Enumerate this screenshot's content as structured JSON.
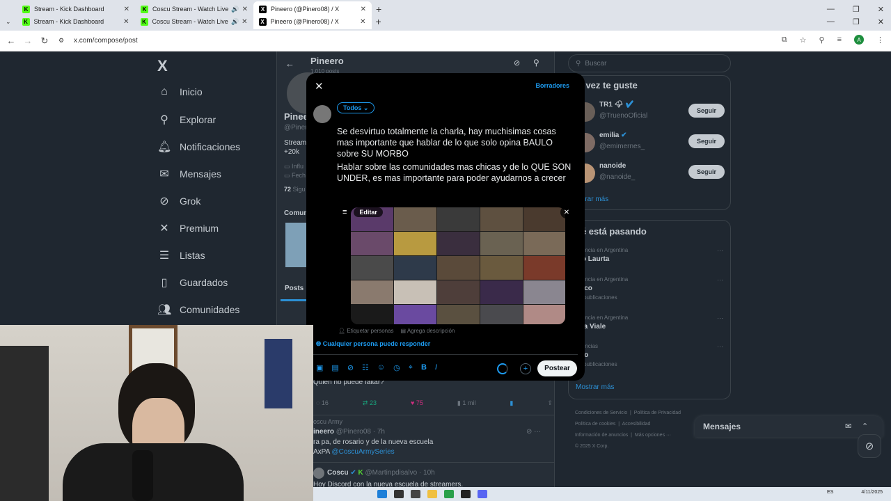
{
  "browser": {
    "tabs_row1": [
      {
        "title": "Stream - Kick Dashboard",
        "favicon": "kick"
      },
      {
        "title": "Coscu Stream - Watch Live",
        "favicon": "kick",
        "audio": true
      },
      {
        "title": "Pineero (@Pinero08) / X",
        "favicon": "x",
        "active": true
      }
    ],
    "tabs_row2": [
      {
        "title": "Stream - Kick Dashboard",
        "favicon": "kick"
      },
      {
        "title": "Coscu Stream - Watch Live",
        "favicon": "kick",
        "audio": true
      },
      {
        "title": "Pineero (@Pinero08) / X",
        "favicon": "x",
        "active": true
      }
    ],
    "url": "x.com/compose/post",
    "profile_initial": "A",
    "new_tab_glyph": "+",
    "close_glyph": "✕"
  },
  "leftnav": {
    "logo": "X",
    "items": [
      {
        "label": "Inicio",
        "icon": "home-icon"
      },
      {
        "label": "Explorar",
        "icon": "search-icon"
      },
      {
        "label": "Notificaciones",
        "icon": "bell-icon"
      },
      {
        "label": "Mensajes",
        "icon": "mail-icon"
      },
      {
        "label": "Grok",
        "icon": "grok-icon"
      },
      {
        "label": "Premium",
        "icon": "x-icon"
      },
      {
        "label": "Listas",
        "icon": "list-icon"
      },
      {
        "label": "Guardados",
        "icon": "bookmark-icon"
      },
      {
        "label": "Comunidades",
        "icon": "people-icon"
      }
    ]
  },
  "profile": {
    "name": "Pineero",
    "posts_count": "1.010 posts",
    "name_partial": "Pinee",
    "handle_partial": "@Piner",
    "bio_partial": "Streame",
    "followers_partial": "+20k",
    "info1": "Influ",
    "info2": "Fech",
    "following": "72",
    "following_label": "Sigu",
    "tab_communities": "Comun",
    "tab_posts": "Posts"
  },
  "timeline": {
    "tweet1_text": "Quien no puede faltar?",
    "tweet1_stats": {
      "replies": "16",
      "retweets": "23",
      "likes": "75",
      "views": "1 mil"
    },
    "community": "oscu Army",
    "tweet2_author": "ineero",
    "tweet2_handle": "@Pinero08 · 7h",
    "tweet2_text": "ra pa, de rosario y de la nueva escuela",
    "tweet2_text2_prefix": "AxPA ",
    "tweet2_mention": "@CoscuArmySeries",
    "tweet3_author": "Coscu",
    "tweet3_handle": "@Martinpdisalvo · 10h",
    "tweet3_text": "Hoy Discord con la nueva escuela de streamers."
  },
  "rightcol": {
    "search_placeholder": "Buscar",
    "suggest_title": "al vez te guste",
    "suggestions": [
      {
        "name": "TR1 🌩",
        "handle": "@TruenoOficial",
        "button": "Seguir"
      },
      {
        "name": "emilia",
        "handle": "@emimernes_",
        "button": "Seguir"
      },
      {
        "name": "nanoide",
        "handle": "@nanoide_",
        "button": "Seguir"
      }
    ],
    "show_more": "ostrar más",
    "trends_title": "ué está pasando",
    "trends": [
      {
        "context": "ndencia en Argentina",
        "title": "blo Laurta",
        "count": ""
      },
      {
        "context": "ndencia en Argentina",
        "title": "onco",
        "count": "64 publicaciones"
      },
      {
        "context": "ndencia en Argentina",
        "title": "ana Viale",
        "count": ""
      },
      {
        "context": "ndencias",
        "title": "ugo",
        "count": "26 publicaciones"
      }
    ],
    "show_more2": "Mostrar más",
    "footer": [
      "Condiciones de Servicio",
      "Política de Privacidad",
      "Política de cookies",
      "Accesibilidad",
      "Información de anuncios",
      "Más opciones ···",
      "© 2025 X Corp."
    ],
    "messages": "Mensajes"
  },
  "compose": {
    "close": "✕",
    "drafts": "Borradores",
    "audience": "Todos ⌄",
    "paragraph1": "Se desvirtuo totalmente la charla, hay muchisimas cosas mas importante que hablar de lo que solo opina BAULO sobre SU MORBO",
    "paragraph2": "Hablar sobre las comunidades mas chicas y de lo QUE SON UNDER, es mas importante para poder ayudarnos a crecer",
    "edit_label": "Editar",
    "tag_people": "Etiquetar personas",
    "add_description": "Agrega descripción",
    "reply_setting": "Cualquier persona puede responder",
    "post_button": "Postear"
  },
  "taskbar": {
    "lang": "ES",
    "date": "4/11/2025"
  },
  "colors": {
    "accent": "#1d9bf0",
    "background": "#000000",
    "kick_green": "#53fc18"
  }
}
